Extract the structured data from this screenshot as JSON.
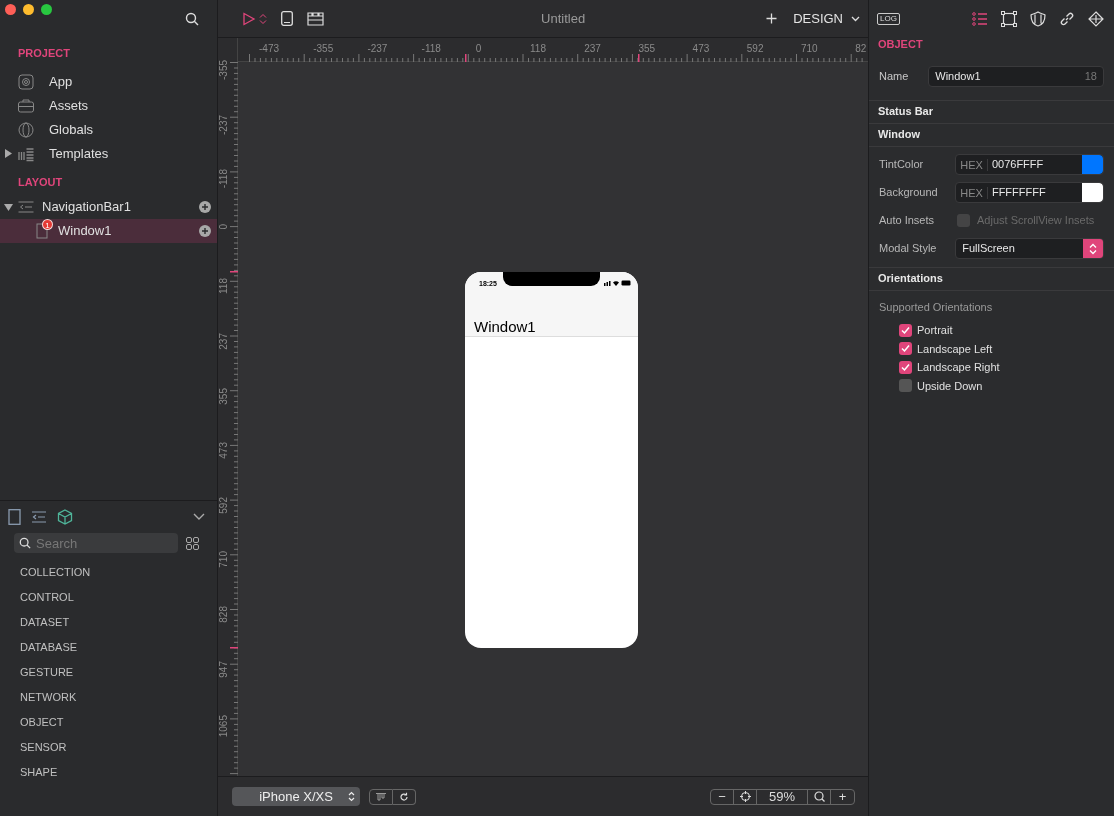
{
  "window": {
    "title": "Untitled"
  },
  "toolbar": {
    "mode": "DESIGN"
  },
  "project": {
    "title": "PROJECT",
    "items": [
      {
        "label": "App",
        "kind": "app"
      },
      {
        "label": "Assets",
        "kind": "assets"
      },
      {
        "label": "Globals",
        "kind": "globals"
      },
      {
        "label": "Templates",
        "kind": "templates",
        "expanded": false
      }
    ]
  },
  "layout": {
    "title": "LAYOUT",
    "tree": [
      {
        "label": "NavigationBar1",
        "kind": "navbar",
        "expanded": true,
        "selected": false,
        "children": [
          {
            "label": "Window1",
            "kind": "window",
            "badge": "1",
            "selected": true
          }
        ]
      }
    ]
  },
  "library": {
    "tabs": [
      {
        "kind": "page",
        "selected": false
      },
      {
        "kind": "list",
        "selected": false
      },
      {
        "kind": "cube",
        "selected": true
      }
    ],
    "search": {
      "placeholder": "Search"
    },
    "categories": [
      "COLLECTION",
      "CONTROL",
      "DATASET",
      "DATABASE",
      "GESTURE",
      "NETWORK",
      "OBJECT",
      "SENSOR",
      "SHAPE"
    ]
  },
  "rulers": {
    "horizontal": [
      "-473",
      "-355",
      "-237",
      "-118",
      "0",
      "118",
      "237",
      "355",
      "473",
      "592",
      "710",
      "82"
    ],
    "vertical": [
      "-355",
      "-237",
      "-118",
      "0",
      "118",
      "237",
      "355",
      "473",
      "592",
      "710",
      "828",
      "947",
      "1065"
    ]
  },
  "phone": {
    "time": "18:25",
    "nav_title": "Window1"
  },
  "bottom_bar": {
    "device": "iPhone X/XS",
    "zoom": "59%",
    "zoom_out": "−",
    "zoom_in": "+"
  },
  "inspector": {
    "log": "LOG",
    "tabs": [
      {
        "kind": "list",
        "selected": true
      },
      {
        "kind": "frame",
        "selected": false
      },
      {
        "kind": "shield",
        "selected": false
      },
      {
        "kind": "link",
        "selected": false
      },
      {
        "kind": "code",
        "selected": false
      }
    ],
    "title": "OBJECT",
    "name": {
      "label": "Name",
      "value": "Window1",
      "count": "18"
    },
    "sections": [
      {
        "title": "Status Bar"
      },
      {
        "title": "Window"
      }
    ],
    "colors": [
      {
        "label": "TintColor",
        "prefix": "HEX",
        "value": "0076FFFF",
        "color": "#0076ff"
      },
      {
        "label": "Background",
        "prefix": "HEX",
        "value": "FFFFFFFF",
        "color": "#ffffff"
      }
    ],
    "auto_insets": {
      "label": "Auto Insets",
      "option": "Adjust ScrollView Insets",
      "checked": false,
      "disabled": true
    },
    "modal_style": {
      "label": "Modal Style",
      "value": "FullScreen"
    },
    "orientations": {
      "title": "Orientations",
      "subtitle": "Supported Orientations",
      "items": [
        {
          "label": "Portrait",
          "checked": true
        },
        {
          "label": "Landscape Left",
          "checked": true
        },
        {
          "label": "Landscape Right",
          "checked": true
        },
        {
          "label": "Upside Down",
          "checked": false
        }
      ]
    }
  }
}
